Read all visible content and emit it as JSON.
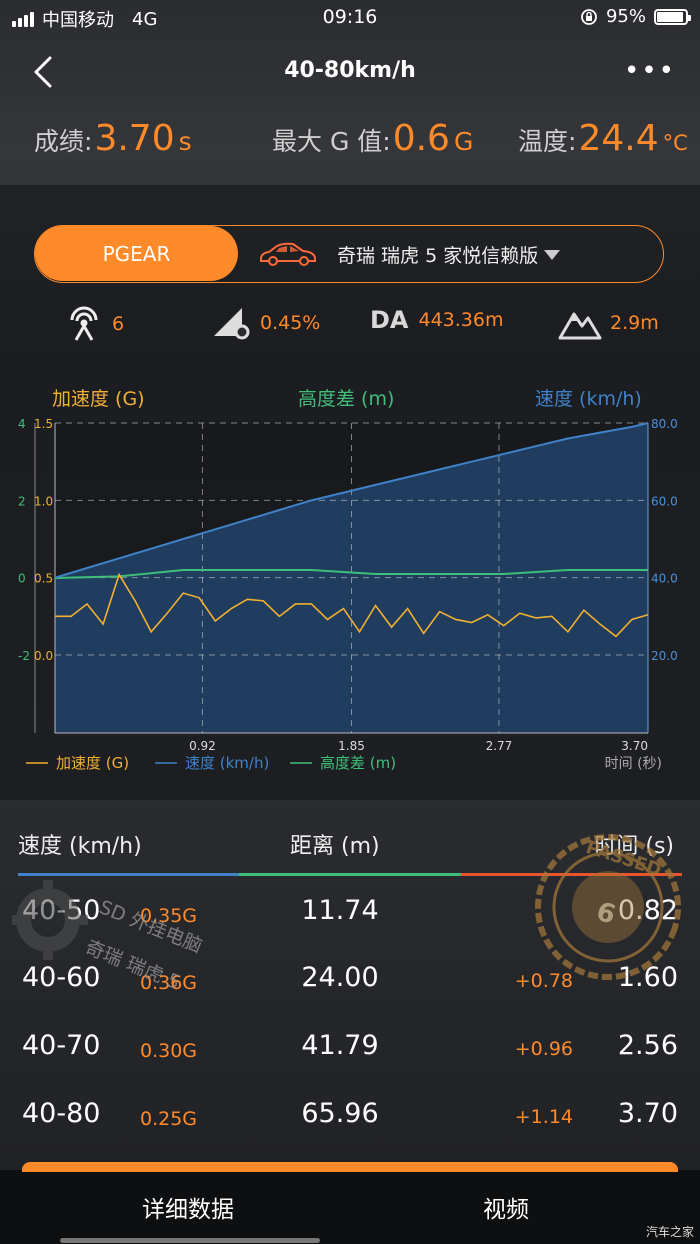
{
  "status_bar": {
    "carrier": "中国移动",
    "network": "4G",
    "time": "09:16",
    "battery": "95%"
  },
  "nav": {
    "title": "40-80km/h"
  },
  "stats": [
    {
      "label": "成绩:",
      "value": "3.70",
      "unit": "s"
    },
    {
      "label": "最大 G 值:",
      "value": "0.6",
      "unit": "G"
    },
    {
      "label": "温度:",
      "value": "24.4",
      "unit": "°C"
    }
  ],
  "device": {
    "brand": "PGEAR",
    "car_model": "奇瑞  瑞虎 5  家悦信赖版"
  },
  "readings": {
    "satellites": "6",
    "slope": "0.45%",
    "da_label": "DA",
    "da_value": "443.36m",
    "altitude": "2.9m"
  },
  "chart_heads": {
    "accel": "加速度 (G)",
    "height": "高度差 (m)",
    "speed": "速度 (km/h)"
  },
  "chart_data": {
    "type": "line",
    "xlabel": "时间 (秒)",
    "x_ticks": [
      "0.92",
      "1.85",
      "2.77",
      "3.70"
    ],
    "xlim": [
      0,
      3.7
    ],
    "y_left_outer_ticks": [
      "4",
      "2",
      "0",
      "-2"
    ],
    "y_left_inner_ticks": [
      "1.5",
      "1.0",
      "0.5",
      "0.0"
    ],
    "y_right_ticks": [
      "80.0",
      "60.0",
      "40.0",
      "20.0"
    ],
    "legend": [
      "加速度 (G)",
      "速度 (km/h)",
      "高度差 (m)"
    ],
    "colors": {
      "accel": "#f0b032",
      "speed": "#3f82c8",
      "height": "#3fbf7a"
    },
    "series": [
      {
        "name": "速度 (km/h)",
        "x": [
          0,
          0.2,
          0.4,
          0.6,
          0.8,
          1.0,
          1.2,
          1.4,
          1.6,
          1.8,
          2.0,
          2.2,
          2.4,
          2.6,
          2.8,
          3.0,
          3.2,
          3.4,
          3.6,
          3.7
        ],
        "values": [
          40,
          42.5,
          45,
          47.5,
          50,
          52.5,
          55,
          57.5,
          60,
          62,
          64,
          66,
          68,
          70,
          72,
          74,
          76,
          77.5,
          79,
          80
        ]
      },
      {
        "name": "加速度 (G)",
        "x": [
          0,
          0.1,
          0.2,
          0.3,
          0.4,
          0.5,
          0.6,
          0.7,
          0.8,
          0.9,
          1.0,
          1.1,
          1.2,
          1.3,
          1.4,
          1.5,
          1.6,
          1.7,
          1.8,
          1.9,
          2.0,
          2.1,
          2.2,
          2.3,
          2.4,
          2.5,
          2.6,
          2.7,
          2.8,
          2.9,
          3.0,
          3.1,
          3.2,
          3.3,
          3.4,
          3.5,
          3.6,
          3.7
        ],
        "values": [
          0.25,
          0.25,
          0.33,
          0.2,
          0.52,
          0.35,
          0.15,
          0.27,
          0.4,
          0.37,
          0.22,
          0.3,
          0.36,
          0.35,
          0.25,
          0.33,
          0.33,
          0.23,
          0.3,
          0.15,
          0.32,
          0.18,
          0.3,
          0.14,
          0.28,
          0.23,
          0.21,
          0.26,
          0.19,
          0.27,
          0.24,
          0.25,
          0.15,
          0.29,
          0.2,
          0.12,
          0.23,
          0.26
        ]
      },
      {
        "name": "高度差 (m)",
        "x": [
          0,
          0.4,
          0.8,
          1.2,
          1.6,
          2.0,
          2.4,
          2.8,
          3.2,
          3.7
        ],
        "values": [
          0.0,
          0.02,
          0.1,
          0.1,
          0.1,
          0.05,
          0.05,
          0.05,
          0.1,
          0.1
        ]
      }
    ]
  },
  "table": {
    "headers": {
      "speed": "速度 (km/h)",
      "distance": "距离 (m)",
      "time": "时间 (s)"
    },
    "rows": [
      {
        "speed": "40-50",
        "g": "0.35G",
        "distance": "11.74",
        "delta": "",
        "time": "0.82"
      },
      {
        "speed": "40-60",
        "g": "0.36G",
        "distance": "24.00",
        "delta": "+0.78",
        "time": "1.60"
      },
      {
        "speed": "40-70",
        "g": "0.30G",
        "distance": "41.79",
        "delta": "+0.96",
        "time": "2.56"
      },
      {
        "speed": "40-80",
        "g": "0.25G",
        "distance": "65.96",
        "delta": "+1.14",
        "time": "3.70"
      }
    ]
  },
  "watermark": {
    "line1": "SD 外挂电脑",
    "line2": "奇瑞  瑞虎 5"
  },
  "stamp": {
    "word": "PASSED",
    "number": "6"
  },
  "bottom_tabs": {
    "detail": "详细数据",
    "video": "视频"
  },
  "credit": "汽车之家"
}
